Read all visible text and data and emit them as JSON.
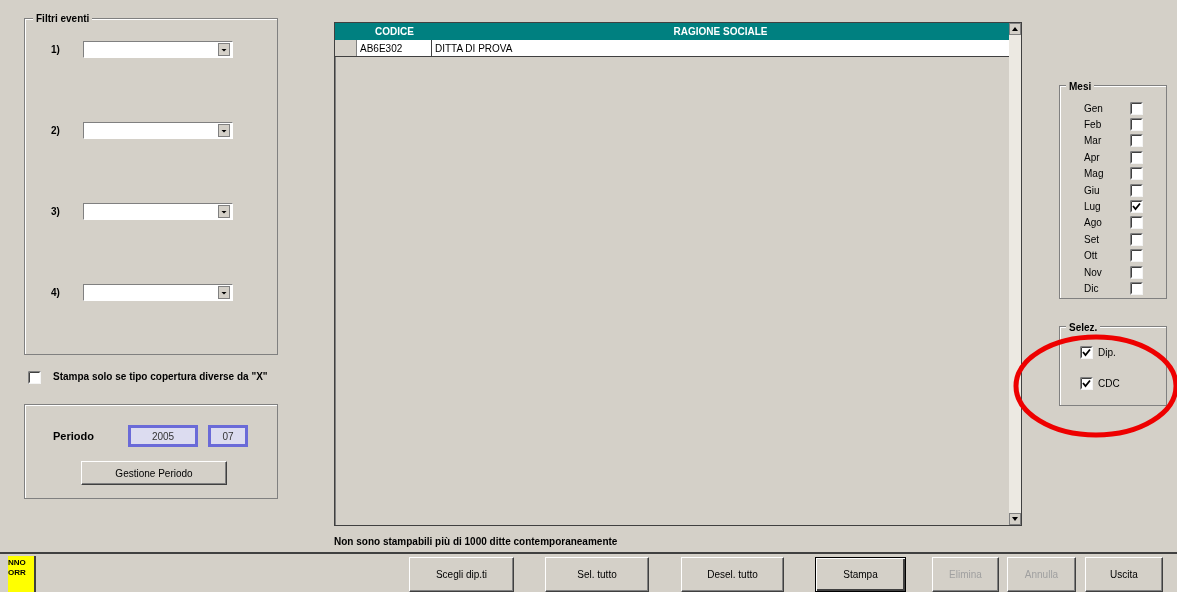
{
  "filter_group": {
    "title": "Filtri eventi",
    "filters": [
      {
        "label": "1)"
      },
      {
        "label": "2)"
      },
      {
        "label": "3)"
      },
      {
        "label": "4)"
      }
    ]
  },
  "print_option": {
    "label": "Stampa solo se tipo copertura diverse da \"X\"",
    "checked": false
  },
  "period": {
    "label": "Periodo",
    "year": "2005",
    "month": "07",
    "button": "Gestione Periodo"
  },
  "table": {
    "columns": [
      "CODICE",
      "RAGIONE SOCIALE"
    ],
    "rows": [
      {
        "cells": [
          "AB6E302",
          "DITTA DI PROVA"
        ]
      }
    ]
  },
  "notice": "Non sono stampabili più di 1000 ditte contemporaneamente",
  "months_group": {
    "title": "Mesi",
    "months": [
      {
        "label": "Gen",
        "checked": false
      },
      {
        "label": "Feb",
        "checked": false
      },
      {
        "label": "Mar",
        "checked": false
      },
      {
        "label": "Apr",
        "checked": false
      },
      {
        "label": "Mag",
        "checked": false
      },
      {
        "label": "Giu",
        "checked": false
      },
      {
        "label": "Lug",
        "checked": true
      },
      {
        "label": "Ago",
        "checked": false
      },
      {
        "label": "Set",
        "checked": false
      },
      {
        "label": "Ott",
        "checked": false
      },
      {
        "label": "Nov",
        "checked": false
      },
      {
        "label": "Dic",
        "checked": false
      }
    ]
  },
  "selection_group": {
    "title": "Selez.",
    "options": [
      {
        "label": "Dip.",
        "checked": true
      },
      {
        "label": "CDC",
        "checked": true
      }
    ]
  },
  "status_badge": [
    "NNO",
    "ORR"
  ],
  "buttons": [
    {
      "label": "Scegli dip.ti",
      "disabled": false,
      "default": false
    },
    {
      "label": "Sel. tutto",
      "disabled": false,
      "default": false
    },
    {
      "label": "Desel. tutto",
      "disabled": false,
      "default": false
    },
    {
      "label": "Stampa",
      "disabled": false,
      "default": true
    },
    {
      "label": "Elimina",
      "disabled": true,
      "default": false
    },
    {
      "label": "Annulla",
      "disabled": true,
      "default": false
    },
    {
      "label": "Uscita",
      "disabled": false,
      "default": false
    }
  ]
}
